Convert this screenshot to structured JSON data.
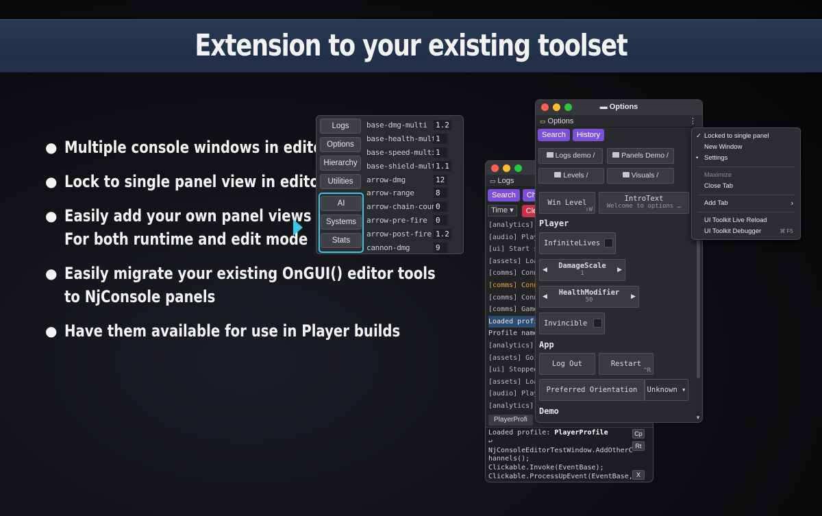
{
  "banner": {
    "title": "Extension to your existing toolset"
  },
  "bullets": [
    [
      "Multiple console windows in editor"
    ],
    [
      "Lock to single panel view in editor"
    ],
    [
      "Easily add your own panel views",
      "For both runtime and edit mode"
    ],
    [
      "Easily migrate your existing OnGUI() editor tools",
      "to NjConsole panels"
    ],
    [
      "Have them available for use in Player builds"
    ]
  ],
  "panel_window": {
    "nav": [
      "Logs",
      "Options",
      "Hierarchy",
      "Utilities"
    ],
    "nav_highlighted": [
      "AI",
      "Systems",
      "Stats"
    ],
    "rows": [
      {
        "k": "base-dmg-multi",
        "v": "1.2"
      },
      {
        "k": "base-health-multi",
        "v": "1"
      },
      {
        "k": "base-speed-multi",
        "v": "1"
      },
      {
        "k": "base-shield-multi",
        "v": "1.1"
      },
      {
        "k": "arrow-dmg",
        "v": "12"
      },
      {
        "k": "arrow-range",
        "v": "8"
      },
      {
        "k": "arrow-chain-count",
        "v": "0"
      },
      {
        "k": "arrow-pre-fire",
        "v": "0"
      },
      {
        "k": "arrow-post-fire",
        "v": "1.2"
      },
      {
        "k": "cannon-dmg",
        "v": "9"
      }
    ],
    "highlight_color": "#3cc6e6"
  },
  "logs_window": {
    "tab": "Logs",
    "search_btn": "Search",
    "channels_btn": "Ch",
    "clear_btn": "Cle",
    "time_select": "Time ▾",
    "lines": [
      {
        "t": "[analytics]",
        "s": ""
      },
      {
        "t": "[audio] Play",
        "s": ""
      },
      {
        "t": "[ui] Start s",
        "s": ""
      },
      {
        "t": "[assets] Loa",
        "s": ""
      },
      {
        "t": "[comms] Conn",
        "s": ""
      },
      {
        "t": "[comms] Conn",
        "s": "warn"
      },
      {
        "t": "[comms] Conn",
        "s": ""
      },
      {
        "t": "[comms] Game",
        "s": ""
      },
      {
        "t": "Loaded profi",
        "s": "sel2"
      },
      {
        "t": "Profile name",
        "s": "hdr"
      },
      {
        "t": "[analytics]",
        "s": ""
      },
      {
        "t": "[assets] Goi",
        "s": ""
      },
      {
        "t": "[ui] Stopped",
        "s": ""
      },
      {
        "t": "[assets] Loa",
        "s": ""
      },
      {
        "t": "[audio] Play",
        "s": ""
      },
      {
        "t": "[analytics]",
        "s": ""
      }
    ],
    "profile_btn": "PlayerProfi",
    "detail_prefix": "Loaded profile: ",
    "detail_bold": "PlayerProfile",
    "detail_lines": [
      "↩",
      "NjConsoleEditorTestWindow.AddOtherC",
      "hannels();",
      "Clickable.Invoke(EventBase);",
      "Clickable.ProcessUpEvent(EventBase,"
    ],
    "detail_buttons": [
      "Cp",
      "Rt",
      "X"
    ]
  },
  "options_window": {
    "title": "Options",
    "tab": "Options",
    "search_btn": "Search",
    "history_btn": "History",
    "folders": [
      "Logs demo /",
      "Panels Demo /",
      "Levels /",
      "Visuals /"
    ],
    "win_level": "Win Level",
    "win_level_sc": "⇧W",
    "intro_title": "IntroText",
    "intro_sub": "Welcome to options …",
    "section_player": "Player",
    "infinite_lives": "InfiniteLives",
    "damage_scale": {
      "label": "DamageScale",
      "value": "1"
    },
    "health_modifier": {
      "label": "HealthModifier",
      "value": "50"
    },
    "invincible": "Invincible",
    "section_app": "App",
    "log_out": "Log Out",
    "restart": "Restart",
    "restart_sc": "^R",
    "pref_orient": "Preferred Orientation",
    "pref_orient_value": "Unknown ▾",
    "section_demo": "Demo"
  },
  "context_menu": {
    "items": [
      {
        "label": "Locked to single panel",
        "mark": "✓"
      },
      {
        "label": "New Window",
        "mark": ""
      },
      {
        "label": "Settings",
        "mark": "•"
      }
    ],
    "group2": [
      {
        "label": "Maximize",
        "disabled": true
      },
      {
        "label": "Close Tab",
        "disabled": false
      }
    ],
    "add_tab": "Add Tab",
    "group3": [
      {
        "label": "UI Toolkit Live Reload",
        "sc": ""
      },
      {
        "label": "UI Toolkit Debugger",
        "sc": "⌘ F5"
      }
    ]
  }
}
